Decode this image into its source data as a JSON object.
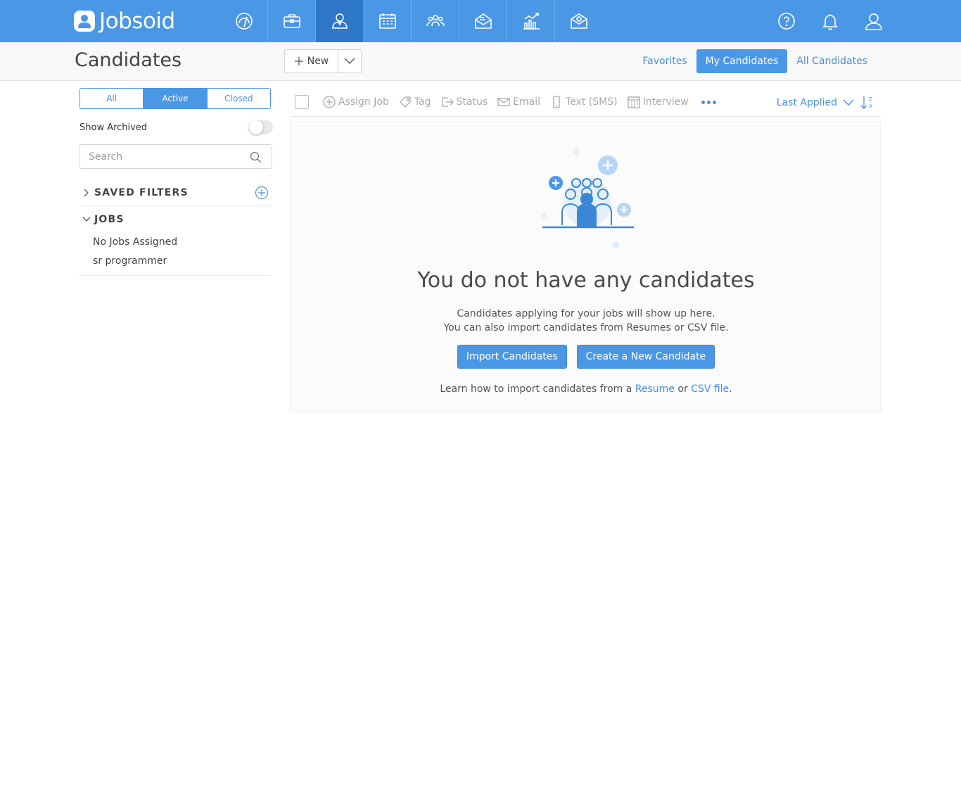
{
  "brand": {
    "name": "Jobsoid"
  },
  "nav": {
    "items": [
      {
        "icon": "dashboard-icon"
      },
      {
        "icon": "briefcase-icon"
      },
      {
        "icon": "candidate-icon",
        "active": true
      },
      {
        "icon": "calendar-icon"
      },
      {
        "icon": "team-icon"
      },
      {
        "icon": "campaign-icon"
      },
      {
        "icon": "reports-icon"
      },
      {
        "icon": "mail-icon"
      }
    ],
    "right_icons": [
      "help-icon",
      "bell-icon",
      "user-icon"
    ]
  },
  "header": {
    "title": "Candidates",
    "new_label": "New",
    "view_tabs": [
      {
        "label": "Favorites"
      },
      {
        "label": "My Candidates",
        "active": true
      },
      {
        "label": "All Candidates"
      }
    ]
  },
  "sidebar": {
    "segments": [
      {
        "label": "All"
      },
      {
        "label": "Active",
        "active": true
      },
      {
        "label": "Closed"
      }
    ],
    "show_archived_label": "Show Archived",
    "show_archived_on": false,
    "search_placeholder": "Search",
    "saved_filters_title": "SAVED FILTERS",
    "jobs_title": "JOBS",
    "jobs": [
      "No Jobs Assigned",
      "sr programmer"
    ]
  },
  "toolbar": {
    "assign_job": "Assign Job",
    "tag": "Tag",
    "status": "Status",
    "email": "Email",
    "text_sms": "Text (SMS)",
    "interview": "Interview",
    "sort_label": "Last Applied"
  },
  "empty_state": {
    "title": "You do not have any candidates",
    "line1": "Candidates applying for your jobs will show up here.",
    "line2": "You can also import candidates from Resumes or CSV file.",
    "import_button": "Import Candidates",
    "create_button": "Create a New Candidate",
    "learn_prefix": "Learn how to import candidates from a",
    "resume_link": "Resume",
    "or_text": "or",
    "csv_link": "CSV file",
    "period": "."
  },
  "colors": {
    "brand_blue": "#4a97e6",
    "active_nav": "#2e77c7",
    "link": "#4a8fd9"
  }
}
